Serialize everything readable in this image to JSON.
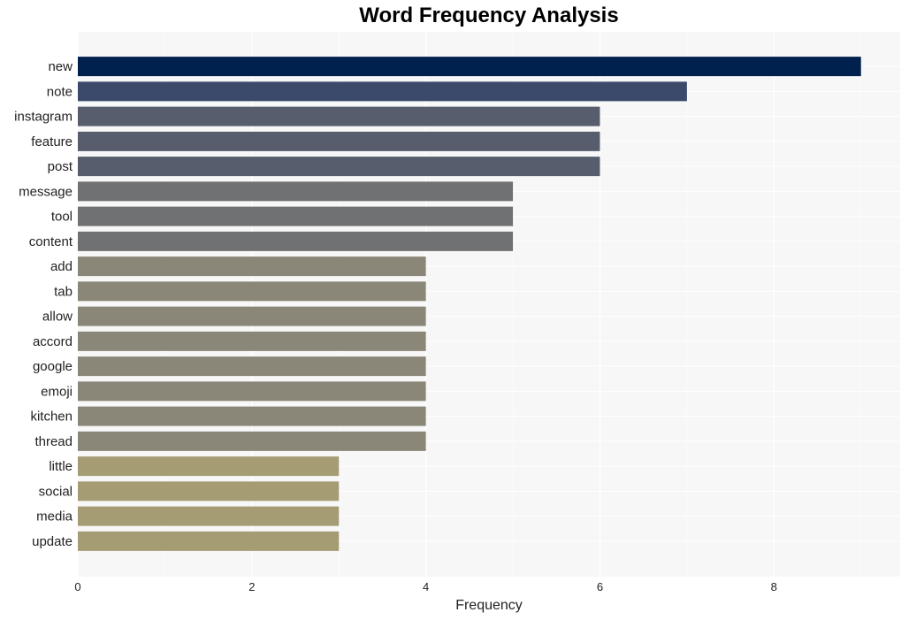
{
  "chart_data": {
    "type": "bar",
    "orientation": "horizontal",
    "title": "Word Frequency Analysis",
    "xlabel": "Frequency",
    "ylabel": "",
    "xlim": [
      0,
      9.45
    ],
    "xticks": [
      0,
      2,
      4,
      6,
      8
    ],
    "xtick_labels": [
      "0",
      "2",
      "4",
      "6",
      "8"
    ],
    "grid": true,
    "categories": [
      "new",
      "note",
      "instagram",
      "feature",
      "post",
      "message",
      "tool",
      "content",
      "add",
      "tab",
      "allow",
      "accord",
      "google",
      "emoji",
      "kitchen",
      "thread",
      "little",
      "social",
      "media",
      "update"
    ],
    "values": [
      9,
      7,
      6,
      6,
      6,
      5,
      5,
      5,
      4,
      4,
      4,
      4,
      4,
      4,
      4,
      4,
      3,
      3,
      3,
      3
    ],
    "colors": [
      "#00204e",
      "#3b4a6b",
      "#575d6d",
      "#575d6d",
      "#575d6d",
      "#707173",
      "#707173",
      "#707173",
      "#8a8779",
      "#8a8779",
      "#8a8779",
      "#8a8779",
      "#8a8779",
      "#8a8779",
      "#8a8779",
      "#8a8779",
      "#a59c74",
      "#a59c74",
      "#a59c74",
      "#a59c74"
    ],
    "background": "#f7f7f7"
  }
}
